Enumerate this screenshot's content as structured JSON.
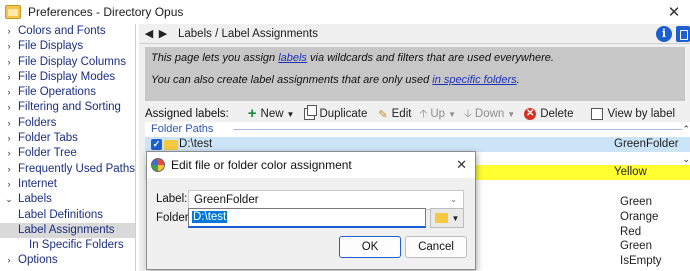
{
  "window": {
    "title": "Preferences - Directory Opus"
  },
  "sidebar": {
    "items": [
      {
        "label": "Colors and Fonts",
        "level": 0
      },
      {
        "label": "File Displays",
        "level": 0
      },
      {
        "label": "File Display Columns",
        "level": 0
      },
      {
        "label": "File Display Modes",
        "level": 0
      },
      {
        "label": "File Operations",
        "level": 0
      },
      {
        "label": "Filtering and Sorting",
        "level": 0
      },
      {
        "label": "Folders",
        "level": 0
      },
      {
        "label": "Folder Tabs",
        "level": 0
      },
      {
        "label": "Folder Tree",
        "level": 0
      },
      {
        "label": "Frequently Used Paths",
        "level": 0
      },
      {
        "label": "Internet",
        "level": 0
      },
      {
        "label": "Labels",
        "level": 0,
        "expanded": true
      },
      {
        "label": "Label Definitions",
        "level": 1
      },
      {
        "label": "Label Assignments",
        "level": 1,
        "selected": true
      },
      {
        "label": "In Specific Folders",
        "level": 2
      },
      {
        "label": "Options",
        "level": 0
      }
    ]
  },
  "nav": {
    "back_icon": "back-arrow",
    "forward_icon": "forward-arrow",
    "breadcrumb": "Labels / Label Assignments"
  },
  "info": {
    "line1_pre": "This page lets you assign ",
    "line1_link": "labels",
    "line1_post": " via wildcards and filters that are used everywhere.",
    "line2_pre": "You can also create label assignments that are only used ",
    "line2_link": "in specific folders",
    "line2_post": "."
  },
  "toolbar": {
    "assigned_label": "Assigned labels:",
    "new": "New",
    "duplicate": "Duplicate",
    "edit": "Edit",
    "up": "Up",
    "down": "Down",
    "delete": "Delete",
    "view_by_label": "View by label"
  },
  "list": {
    "group": "Folder Paths",
    "selected_row": {
      "path": "D:\\test",
      "label": "GreenFolder"
    },
    "yellow_label": "Yellow",
    "other_labels": [
      "Green",
      "Orange",
      "Red",
      "Green",
      "IsEmpty"
    ]
  },
  "dialog": {
    "title": "Edit file or folder color assignment",
    "label_caption": "Label:",
    "label_value": "GreenFolder",
    "folder_caption": "Folder:",
    "folder_value": "D:\\test",
    "ok": "OK",
    "cancel": "Cancel"
  },
  "colors": {
    "accent": "#1c5fd0",
    "selection": "#cce4f7",
    "yellow_label": "#ffff32",
    "info_panel": "#c7c7c7"
  }
}
